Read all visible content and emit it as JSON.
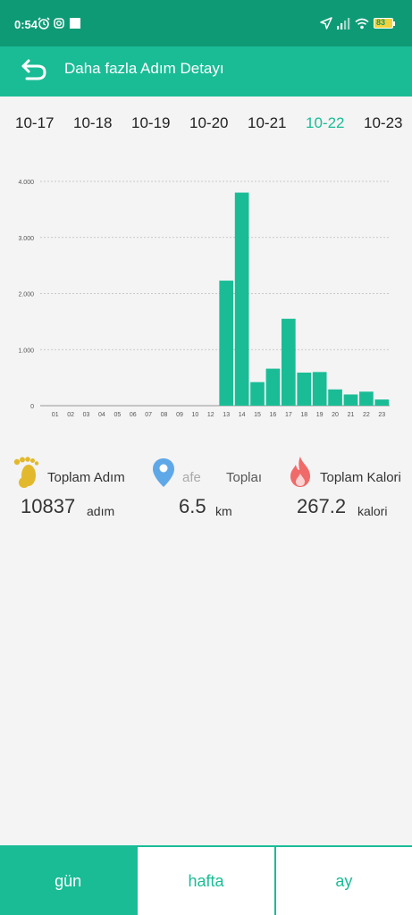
{
  "status_bar": {
    "time": "0:54",
    "battery": "83"
  },
  "header": {
    "title": "Daha fazla Adım Detayı"
  },
  "dates": [
    "10-17",
    "10-18",
    "10-19",
    "10-20",
    "10-21",
    "10-22",
    "10-23"
  ],
  "selected_date": "10-22",
  "chart_data": {
    "type": "bar",
    "categories": [
      "01",
      "02",
      "03",
      "04",
      "05",
      "06",
      "07",
      "08",
      "09",
      "10",
      "12",
      "13",
      "14",
      "15",
      "16",
      "17",
      "18",
      "19",
      "20",
      "21",
      "22",
      "23"
    ],
    "values": [
      0,
      0,
      0,
      0,
      0,
      0,
      0,
      0,
      0,
      0,
      0,
      2230,
      3800,
      420,
      660,
      1550,
      590,
      600,
      290,
      200,
      250,
      110
    ],
    "y_ticks": [
      "0",
      "1.000",
      "2.000",
      "3.000",
      "4.000"
    ],
    "ylim": [
      0,
      4000
    ],
    "grid": true,
    "bar_color": "#1abc96",
    "title": "",
    "xlabel": "",
    "ylabel": ""
  },
  "stats": {
    "steps": {
      "label": "Toplam Adım",
      "value": "10837",
      "unit": "adım"
    },
    "distance": {
      "label_left": "afe",
      "label_right": "Toplaı",
      "value": "6.5",
      "unit": "km"
    },
    "calories": {
      "label": "Toplam Kalori",
      "value": "267.2",
      "unit": "kalori"
    }
  },
  "tabs": [
    "gün",
    "hafta",
    "ay"
  ],
  "active_tab": "gün",
  "colors": {
    "accent": "#1abc96",
    "status_bar": "#0f9a76"
  }
}
